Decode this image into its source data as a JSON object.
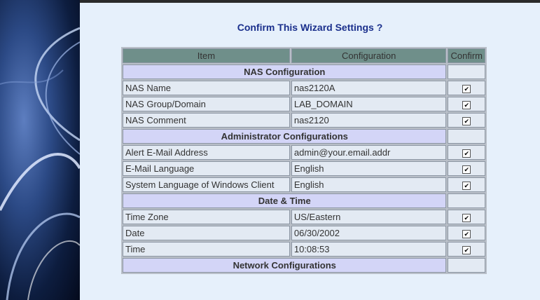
{
  "title": "Confirm This Wizard Settings ?",
  "columns": [
    "Item",
    "Configuration",
    "Confirm"
  ],
  "sections": [
    {
      "heading": "NAS Configuration",
      "rows": [
        {
          "item": "NAS Name",
          "value": "nas2120A",
          "checked": true
        },
        {
          "item": "NAS Group/Domain",
          "value": "LAB_DOMAIN",
          "checked": true
        },
        {
          "item": "NAS Comment",
          "value": "nas2120",
          "checked": true
        }
      ]
    },
    {
      "heading": "Administrator Configurations",
      "rows": [
        {
          "item": "Alert E-Mail Address",
          "value": "admin@your.email.addr",
          "checked": true
        },
        {
          "item": "E-Mail Language",
          "value": "English",
          "checked": true
        },
        {
          "item": "System Language of Windows Client",
          "value": "English",
          "checked": true
        }
      ]
    },
    {
      "heading": "Date & Time",
      "rows": [
        {
          "item": "Time Zone",
          "value": "US/Eastern",
          "checked": true
        },
        {
          "item": "Date",
          "value": "06/30/2002",
          "checked": true
        },
        {
          "item": "Time",
          "value": "10:08:53",
          "checked": true
        }
      ]
    },
    {
      "heading": "Network Configurations",
      "rows": []
    }
  ],
  "colors": {
    "accent": "#1a2f8c",
    "header_bg": "#6f8f8a",
    "section_bg": "#d3d5f7",
    "panel_bg": "#e6f0fb"
  }
}
